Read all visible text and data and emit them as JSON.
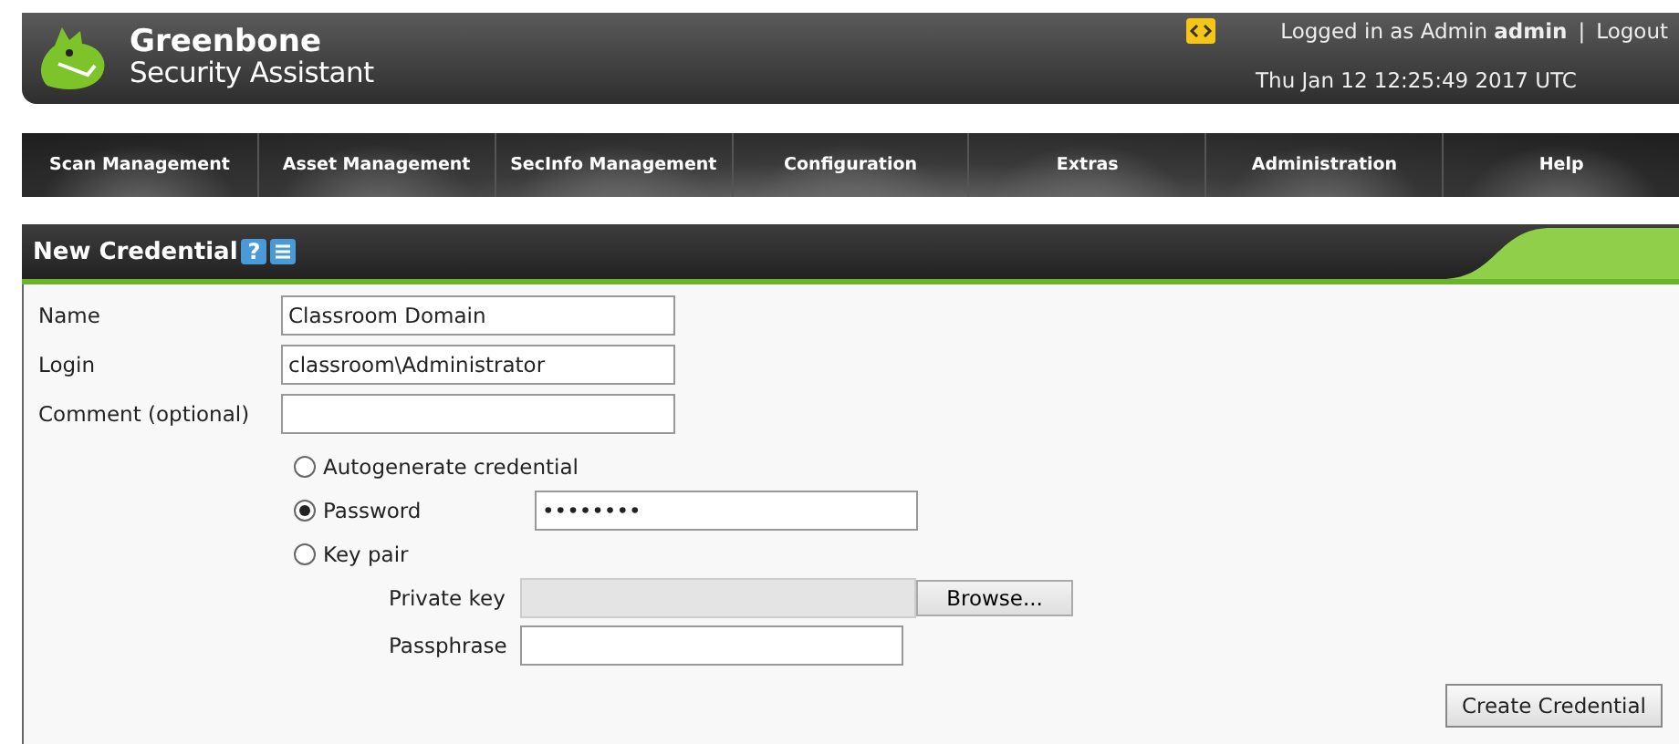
{
  "header": {
    "logo_title": "Greenbone",
    "logo_subtitle": "Security Assistant",
    "login_text": "Logged in as Admin **admin**",
    "separator": "|",
    "logout": "Logout",
    "datetime": "Thu Jan 12 12:25:49 2017 UTC"
  },
  "nav": [
    {
      "label": "Scan Management"
    },
    {
      "label": "Asset Management"
    },
    {
      "label": "SecInfo Management"
    },
    {
      "label": "Configuration"
    },
    {
      "label": "Extras"
    },
    {
      "label": "Administration"
    },
    {
      "label": "Help"
    }
  ],
  "panel": {
    "title": "New Credential",
    "help_icon": "?"
  },
  "fields": [
    {
      "label": "Name",
      "value": "Classroom Domain"
    },
    {
      "label": "Login",
      "value": "classroom\\Administrator"
    },
    {
      "label": "Comment (optional)"
    }
  ],
  "options": [
    {
      "label": "Autogenerate credential",
      "selected": false
    },
    {
      "label": "Password",
      "selected": true,
      "value": "••••••••"
    },
    {
      "label": "Key pair",
      "selected": false
    }
  ],
  "key_fields": [
    {
      "label": "Private key",
      "kind": "file",
      "button": "Browse..."
    },
    {
      "label": "Passphrase",
      "kind": "text"
    }
  ],
  "submit": "Create Credential"
}
